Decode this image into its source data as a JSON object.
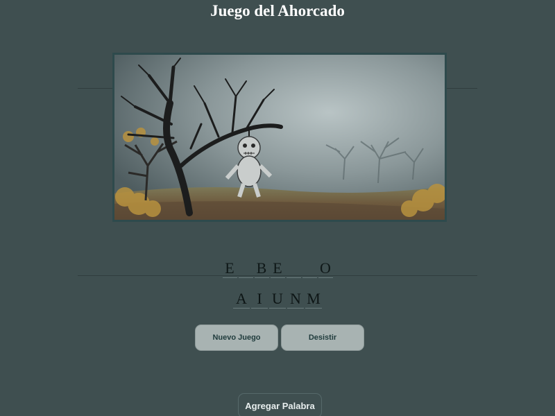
{
  "page": {
    "title": "Juego del Ahorcado"
  },
  "game": {
    "word_slots": [
      "E",
      "",
      "B",
      "E",
      "",
      "",
      "O"
    ],
    "wrong_letters": [
      "A",
      "I",
      "U",
      "N",
      "M"
    ]
  },
  "buttons": {
    "new_game": "Nuevo Juego",
    "give_up": "Desistir",
    "add_word": "Agregar Palabra"
  },
  "colors": {
    "background": "#3f4f50",
    "button_bg": "#a8b3b2",
    "button_text": "#1f3b3c",
    "scene_border": "#2e4a4c"
  },
  "icons": {
    "scene": "hanging-doll-scene"
  }
}
